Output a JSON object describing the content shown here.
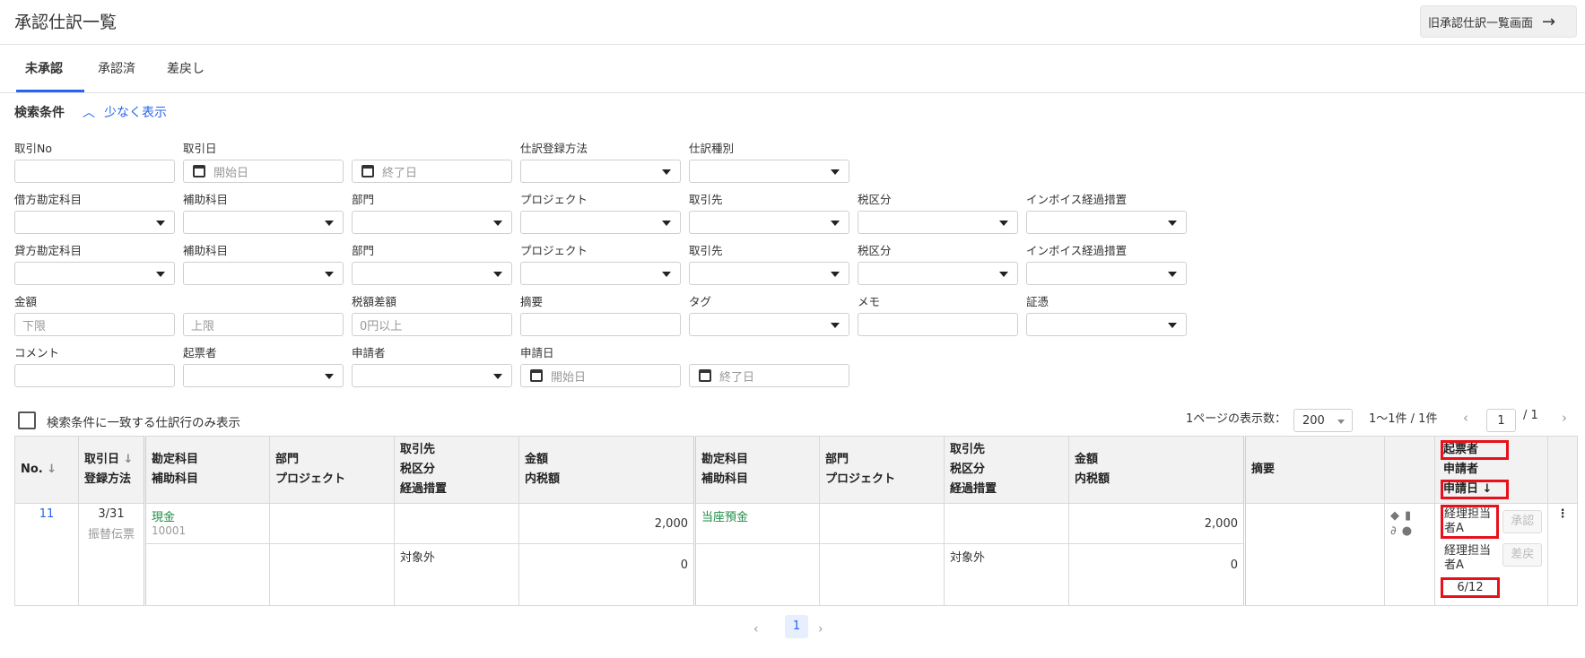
{
  "header": {
    "title": "承認仕訳一覧",
    "old_button": "旧承認仕訳一覧画面"
  },
  "tabs": [
    {
      "label": "未承認"
    },
    {
      "label": "承認済"
    },
    {
      "label": "差戻し"
    }
  ],
  "search": {
    "heading": "検索条件",
    "toggle": "少なく表示",
    "labels": {
      "transaction_no": "取引No",
      "transaction_date": "取引日",
      "registration_method": "仕訳登録方法",
      "journal_type": "仕訳種別",
      "debit_account": "借方勘定科目",
      "sub_account": "補助科目",
      "department": "部門",
      "project": "プロジェクト",
      "partner": "取引先",
      "tax_category": "税区分",
      "invoice_transition": "インボイス経過措置",
      "credit_account": "貸方勘定科目",
      "amount": "金額",
      "tax_diff": "税額差額",
      "summary": "摘要",
      "tag": "タグ",
      "memo": "メモ",
      "evidence": "証憑",
      "comment": "コメント",
      "creator": "起票者",
      "applicant": "申請者",
      "application_date": "申請日"
    },
    "placeholders": {
      "start_date": "開始日",
      "end_date": "終了日",
      "lower": "下限",
      "upper": "上限",
      "tax_min": "0円以上"
    },
    "only_matching_label": "検索条件に一致する仕訳行のみ表示"
  },
  "pagination": {
    "per_page_label": "1ページの表示数：",
    "per_page": "200",
    "range": "1〜1件 / 1件",
    "current_page": "1",
    "total_pages": "/ 1"
  },
  "table": {
    "headers": {
      "no": "No.",
      "date": "取引日",
      "method": "登録方法",
      "account": "勘定科目",
      "sub": "補助科目",
      "dept": "部門",
      "proj": "プロジェクト",
      "partner": "取引先",
      "tax": "税区分",
      "transition": "経過措置",
      "amount": "金額",
      "tax_incl": "内税額",
      "summary": "摘要",
      "creator": "起票者",
      "applicant": "申請者",
      "apply_date": "申請日"
    },
    "sort_icon": "↓",
    "row": {
      "no": "11",
      "date": "3/31",
      "method": "振替伝票",
      "debit_account": "現金",
      "debit_code": "10001",
      "debit_amount": "2,000",
      "debit_tax_label": "対象外",
      "debit_tax_amount": "0",
      "credit_account": "当座預金",
      "credit_amount": "2,000",
      "credit_tax_label": "対象外",
      "credit_tax_amount": "0",
      "creator": "経理担当者A",
      "applicant": "経理担当者A",
      "apply_date": "6/12",
      "approve": "承認",
      "reject": "差戻"
    }
  },
  "bottom_page": "1"
}
